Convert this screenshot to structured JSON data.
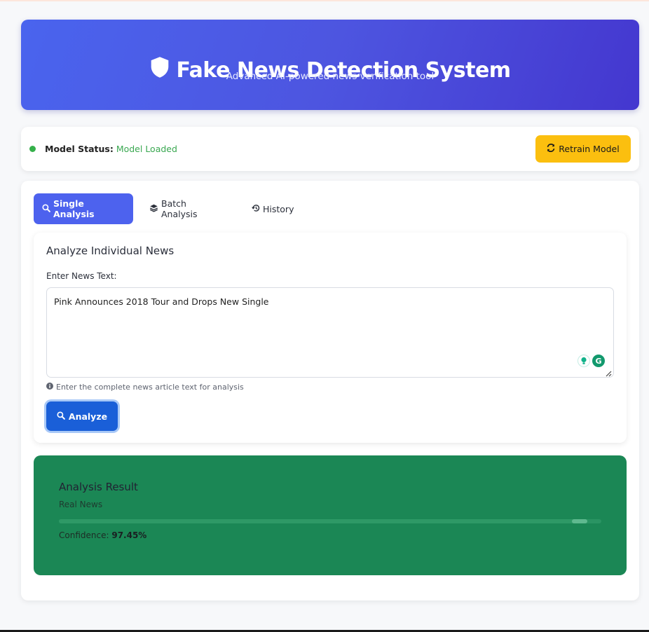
{
  "header": {
    "title": "Fake News Detection System",
    "subtitle": "Advanced AI-powered news verification tool"
  },
  "status": {
    "label": "Model Status:",
    "value": "Model Loaded",
    "retrain_label": "Retrain Model"
  },
  "tabs": [
    {
      "label": "Single Analysis",
      "icon": "search-icon",
      "active": true
    },
    {
      "label": "Batch Analysis",
      "icon": "layers-icon",
      "active": false
    },
    {
      "label": "History",
      "icon": "history-icon",
      "active": false
    }
  ],
  "form": {
    "title": "Analyze Individual News",
    "field_label": "Enter News Text:",
    "text_value": "Pink Announces 2018 Tour and Drops New Single",
    "hint": "Enter the complete news article text for analysis",
    "analyze_label": "Analyze"
  },
  "result": {
    "title": "Analysis Result",
    "label": "Real News",
    "confidence_label": "Confidence:",
    "confidence_value": "97.45%",
    "confidence_fraction": 0.9745
  },
  "colors": {
    "header_start": "#4a64ee",
    "header_end": "#4437cf",
    "active_tab": "#4d62ee",
    "retrain_button": "#fbbf0f",
    "analyze_button": "#1a5fd8",
    "result_background": "#1b8755",
    "status_ok": "#35b04a"
  }
}
